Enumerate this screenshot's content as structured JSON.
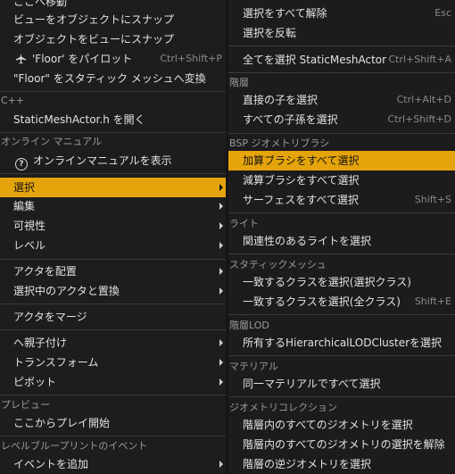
{
  "left_menu": {
    "items": [
      {
        "label": "ここへ移動"
      },
      {
        "label": "ビューをオブジェクトにスナップ"
      },
      {
        "label": "オブジェクトをビューにスナップ"
      },
      {
        "label": "'Floor' をパイロット",
        "shortcut": "Ctrl+Shift+P",
        "icon": "plane-icon"
      },
      {
        "label": "\"Floor\" をスタティック メッシュへ変換"
      },
      {
        "label": "StaticMeshActor.h を開く"
      },
      {
        "label": "オンラインマニュアルを表示",
        "icon": "help-icon"
      },
      {
        "label": "選択",
        "submenu": true,
        "highlighted": true
      },
      {
        "label": "編集",
        "submenu": true
      },
      {
        "label": "可視性",
        "submenu": true
      },
      {
        "label": "レベル",
        "submenu": true
      },
      {
        "label": "アクタを配置",
        "submenu": true
      },
      {
        "label": "選択中のアクタと置換",
        "submenu": true
      },
      {
        "label": "アクタをマージ"
      },
      {
        "label": "へ親子付け",
        "submenu": true
      },
      {
        "label": "トランスフォーム",
        "submenu": true
      },
      {
        "label": "ピボット",
        "submenu": true
      },
      {
        "label": "ここからプレイ開始"
      },
      {
        "label": "イベントを追加",
        "submenu": true
      }
    ],
    "headers": [
      "C++",
      "オンライン マニュアル",
      "プレビュー",
      "レベルブループリントのイベント"
    ]
  },
  "right_menu": {
    "items": [
      {
        "label": "選択をすべて解除",
        "shortcut": "Esc"
      },
      {
        "label": "選択を反転"
      },
      {
        "label": "全てを選択 StaticMeshActor",
        "shortcut": "Ctrl+Shift+A"
      },
      {
        "label": "直接の子を選択",
        "shortcut": "Ctrl+Alt+D"
      },
      {
        "label": "すべての子孫を選択",
        "shortcut": "Ctrl+Shift+D"
      },
      {
        "label": "加算ブラシをすべて選択",
        "highlighted": true
      },
      {
        "label": "減算ブラシをすべて選択"
      },
      {
        "label": "サーフェスをすべて選択",
        "shortcut": "Shift+S"
      },
      {
        "label": "関連性のあるライトを選択"
      },
      {
        "label": "一致するクラスを選択(選択クラス)"
      },
      {
        "label": "一致するクラスを選択(全クラス)",
        "shortcut": "Shift+E"
      },
      {
        "label": "所有するHierarchicalLODClusterを選択"
      },
      {
        "label": "同一マテリアルですべて選択"
      },
      {
        "label": "階層内のすべてのジオメトリを選択"
      },
      {
        "label": "階層内のすべてのジオメトリの選択を解除"
      },
      {
        "label": "階層の逆ジオメトリを選択"
      }
    ],
    "headers": [
      "階層",
      "BSP ジオメトリブラシ",
      "ライト",
      "スタティックメッシュ",
      "階層LOD",
      "マテリアル",
      "ジオメトリコレクション"
    ]
  },
  "colors": {
    "highlight": "#e5a40b",
    "menu_bg": "#1d1d1d",
    "text": "#e2e2e2",
    "header": "#9a9a9a",
    "shortcut": "#8a8a8a"
  }
}
